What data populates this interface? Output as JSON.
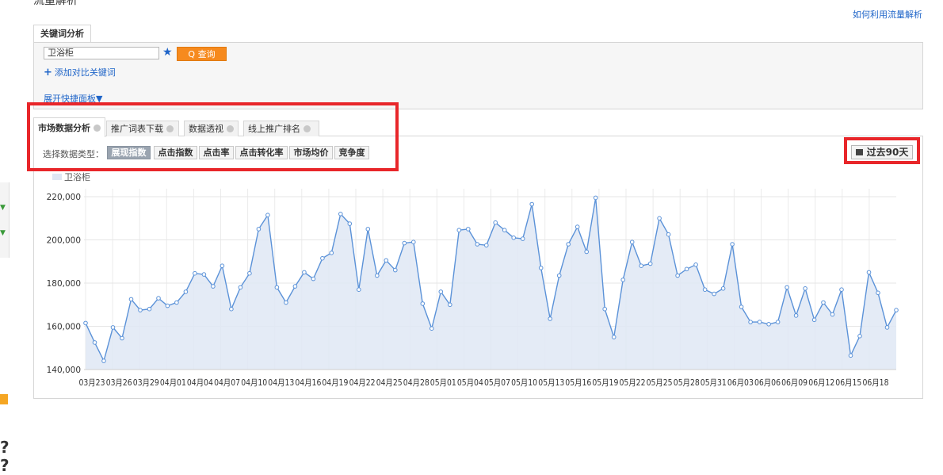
{
  "header": {
    "title": "流量解析",
    "help_link": "如何利用流量解析"
  },
  "keyword_panel": {
    "tab_label": "关键词分析",
    "input_value": "卫浴柜",
    "query_button": "Q 查询",
    "add_compare": "添加对比关键词",
    "expand_panel": "展开快捷面板▼"
  },
  "tabs": [
    {
      "label": "市场数据分析"
    },
    {
      "label": "推广词表下载"
    },
    {
      "label": "数据透视"
    },
    {
      "label": "线上推广排名"
    }
  ],
  "data_type": {
    "label": "选择数据类型：",
    "options": [
      "展现指数",
      "点击指数",
      "点击率",
      "点击转化率",
      "市场均价",
      "竞争度"
    ],
    "selected": "展现指数"
  },
  "time_range": "过去90天",
  "colors": {
    "line": "#5b92d8",
    "fill": "#dfe7f4",
    "highlight": "#e8262a",
    "accent": "#f68a1e"
  },
  "chart_data": {
    "type": "area",
    "series": [
      {
        "name": "卫浴柜",
        "values": [
          161500,
          152500,
          144000,
          159500,
          154500,
          172500,
          167500,
          168000,
          173000,
          169500,
          171000,
          176000,
          184500,
          184000,
          178500,
          188000,
          168000,
          178000,
          184500,
          205000,
          211500,
          178000,
          171000,
          178500,
          185000,
          182000,
          191500,
          194000,
          212000,
          207500,
          177000,
          205000,
          183500,
          190500,
          186000,
          198500,
          199000,
          170500,
          159000,
          176000,
          170000,
          204500,
          205000,
          198000,
          197500,
          208000,
          204500,
          201000,
          200500,
          216500,
          187000,
          163500,
          183500,
          198000,
          206000,
          194500,
          219500,
          168000,
          155000,
          181500,
          199000,
          188000,
          189000,
          210000,
          202500,
          183500,
          186500,
          188500,
          177000,
          175000,
          177500,
          198000,
          169000,
          162000,
          162000,
          161000,
          162000,
          178000,
          165000,
          177500,
          163000,
          171000,
          165500,
          177000,
          146500,
          155500,
          185000,
          175500,
          159500,
          167500
        ]
      }
    ],
    "x_labels": [
      "03月23",
      "03月26",
      "03月29",
      "04月01",
      "04月04",
      "04月07",
      "04月10",
      "04月13",
      "04月16",
      "04月19",
      "04月22",
      "04月25",
      "04月28",
      "05月01",
      "05月04",
      "05月07",
      "05月10",
      "05月13",
      "05月16",
      "05月19",
      "05月22",
      "05月25",
      "05月28",
      "05月31",
      "06月03",
      "06月06",
      "06月09",
      "06月12",
      "06月15",
      "06月18"
    ],
    "y_ticks": [
      "140,000",
      "160,000",
      "180,000",
      "200,000",
      "220,000"
    ],
    "ylim": [
      140000,
      220000
    ]
  }
}
